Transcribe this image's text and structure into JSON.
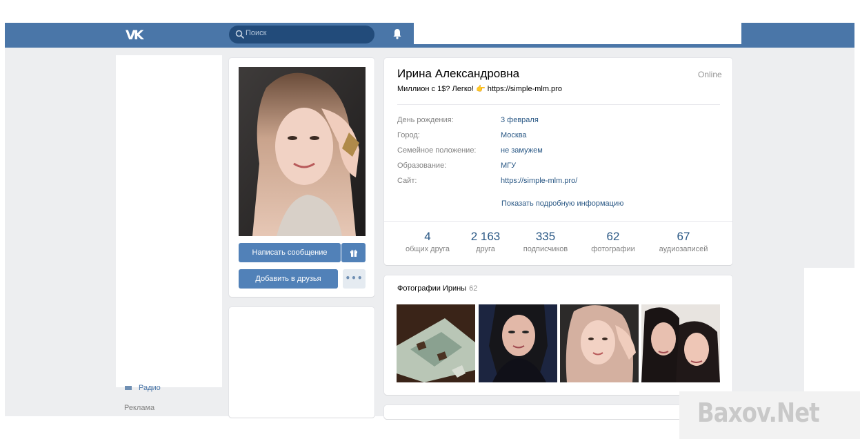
{
  "header": {
    "logo_text": "VK",
    "search_placeholder": "Поиск"
  },
  "left_menu": {
    "partial_item": "Радио",
    "ads": "Реклама"
  },
  "profile": {
    "name": "Ирина Александровна",
    "online": "Online",
    "status_text": "Миллион с 1$? Легко! 👉 https://simple-mlm.pro",
    "buttons": {
      "message": "Написать сообщение",
      "add_friend": "Добавить в друзья",
      "more": "•••"
    },
    "fields": [
      {
        "label": "День рождения:",
        "value": "3 февраля"
      },
      {
        "label": "Город:",
        "value": "Москва"
      },
      {
        "label": "Семейное положение:",
        "value": "не замужем"
      },
      {
        "label": "Образование:",
        "value": "МГУ"
      },
      {
        "label": "Сайт:",
        "value": "https://simple-mlm.pro/"
      }
    ],
    "show_more": "Показать подробную информацию",
    "counters": [
      {
        "num": "4",
        "label": "общих друга"
      },
      {
        "num": "2 163",
        "label": "друга"
      },
      {
        "num": "335",
        "label": "подписчиков"
      },
      {
        "num": "62",
        "label": "фотографии"
      },
      {
        "num": "67",
        "label": "аудиозаписей"
      }
    ],
    "photos": {
      "title": "Фотографии Ирины",
      "count": "62"
    }
  },
  "watermark": "Baxov.Net",
  "colors": {
    "header_bg": "#4a76a8",
    "button_bg": "#5181b8",
    "link": "#2a5885",
    "page_bg": "#edeef0"
  }
}
